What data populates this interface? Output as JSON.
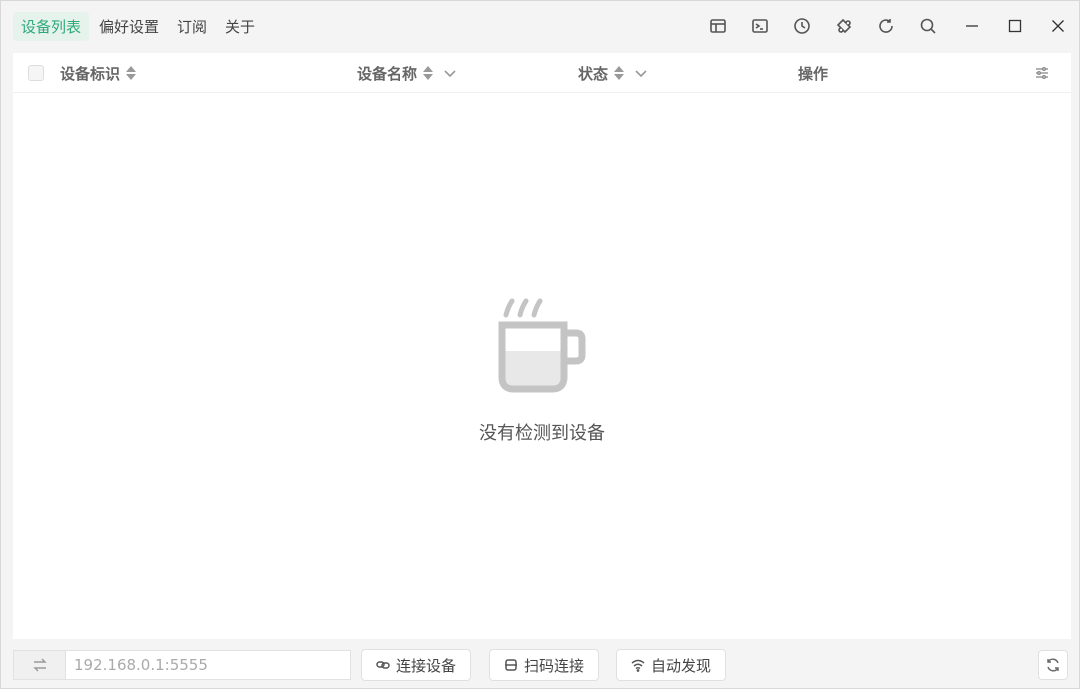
{
  "menu": {
    "items": [
      {
        "label": "设备列表",
        "active": true
      },
      {
        "label": "偏好设置",
        "active": false
      },
      {
        "label": "订阅",
        "active": false
      },
      {
        "label": "关于",
        "active": false
      }
    ]
  },
  "toolbar": {
    "icons": [
      "layout-icon",
      "terminal-icon",
      "history-icon",
      "extension-icon",
      "refresh-icon",
      "search-icon"
    ]
  },
  "window_controls": [
    "minimize-icon",
    "maximize-icon",
    "close-icon"
  ],
  "table": {
    "columns": {
      "id": "设备标识",
      "name": "设备名称",
      "status": "状态",
      "actions": "操作"
    },
    "rows": []
  },
  "empty_state": {
    "icon": "coffee-cup-icon",
    "text": "没有检测到设备"
  },
  "bottom": {
    "address_placeholder": "192.168.0.1:5555",
    "connect_label": "连接设备",
    "scan_label": "扫码连接",
    "discover_label": "自动发现"
  },
  "colors": {
    "accent": "#2eaa7a",
    "accent_bg": "#e6f2ec",
    "window_bg": "#f4f4f4",
    "panel_bg": "#ffffff",
    "cup": "#c4c4c4"
  }
}
